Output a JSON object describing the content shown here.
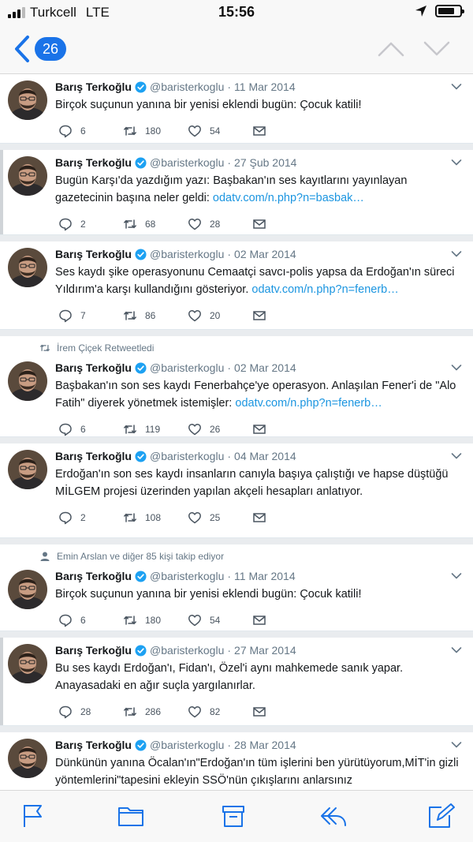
{
  "status_bar": {
    "carrier": "Turkcell",
    "network": "LTE",
    "time": "15:56",
    "battery_level": 0.75
  },
  "nav": {
    "badge_count": "26",
    "accent": "#1a73e8"
  },
  "tweets": [
    {
      "context": "",
      "name": "Barış Terkoğlu",
      "handle": "@baristerkoglu",
      "separator": "·",
      "date": "11 Mar 2014",
      "text": "Birçok suçunun yanına bir yenisi eklendi bugün: Çocuk katili!",
      "link": "",
      "replies": "6",
      "retweets": "180",
      "likes": "54"
    },
    {
      "context": "",
      "name": "Barış Terkoğlu",
      "handle": "@baristerkoglu",
      "separator": "·",
      "date": "27 Şub 2014",
      "text": "Bugün Karşı'da yazdığım yazı: Başbakan'ın ses kayıtlarını yayınlayan gazetecinin başına neler geldi:",
      "link": "odatv.com/n.php?n=basbak…",
      "replies": "2",
      "retweets": "68",
      "likes": "28"
    },
    {
      "context": "",
      "name": "Barış Terkoğlu",
      "handle": "@baristerkoglu",
      "separator": "·",
      "date": "02 Mar 2014",
      "text": "Ses kaydı şike operasyonunu Cemaatçi savcı-polis yapsa da Erdoğan'ın süreci Yıldırım'a karşı kullandığını gösteriyor.",
      "link": "odatv.com/n.php?n=fenerb…",
      "replies": "7",
      "retweets": "86",
      "likes": "20"
    },
    {
      "context": "İrem Çiçek Retweetledi",
      "name": "Barış Terkoğlu",
      "handle": "@baristerkoglu",
      "separator": "·",
      "date": "02 Mar 2014",
      "text": "Başbakan'ın son ses kaydı Fenerbahçe'ye operasyon. Anlaşılan Fener'i de \"Alo Fatih\" diyerek yönetmek istemişler:",
      "link": "odatv.com/n.php?n=fenerb…",
      "replies": "6",
      "retweets": "119",
      "likes": "26"
    },
    {
      "context": "",
      "name": "Barış Terkoğlu",
      "handle": "@baristerkoglu",
      "separator": "·",
      "date": "04 Mar 2014",
      "text": "Erdoğan'ın son ses kaydı insanların canıyla başıya çalıştığı ve hapse düştüğü MİLGEM projesi üzerinden yapılan akçeli hesapları anlatıyor.",
      "link": "",
      "replies": "2",
      "retweets": "108",
      "likes": "25"
    },
    {
      "context": "Emin Arslan ve diğer 85 kişi takip ediyor",
      "name": "Barış Terkoğlu",
      "handle": "@baristerkoglu",
      "separator": "·",
      "date": "11 Mar 2014",
      "text": "Birçok suçunun yanına bir yenisi eklendi bugün: Çocuk katili!",
      "link": "",
      "replies": "6",
      "retweets": "180",
      "likes": "54"
    },
    {
      "context": "",
      "name": "Barış Terkoğlu",
      "handle": "@baristerkoglu",
      "separator": "·",
      "date": "27 Mar 2014",
      "text": "Bu ses kaydı Erdoğan'ı, Fidan'ı, Özel'i aynı mahkemede sanık yapar. Anayasadaki en ağır suçla yargılanırlar.",
      "link": "",
      "replies": "28",
      "retweets": "286",
      "likes": "82"
    },
    {
      "context": "",
      "name": "Barış Terkoğlu",
      "handle": "@baristerkoglu",
      "separator": "·",
      "date": "28 Mar 2014",
      "text": "Dünkünün yanına Öcalan'ın\"Erdoğan'ın tüm işlerini ben yürütüyorum,MİT'in gizli yöntemlerini\"tapesini ekleyin SSÖ'nün çıkışlarını anlarsınız",
      "link": "",
      "replies": "",
      "retweets": "",
      "likes": ""
    }
  ],
  "colors": {
    "link": "#1b95e0",
    "verified": "#1da1f2",
    "secondary": "#657786"
  },
  "icons": [
    "back-chevron-icon",
    "up-chevron-icon",
    "down-chevron-icon",
    "reply-icon",
    "retweet-icon",
    "like-icon",
    "message-icon",
    "flag-icon",
    "folder-icon",
    "archive-icon",
    "reply-toolbar-icon",
    "compose-icon"
  ]
}
